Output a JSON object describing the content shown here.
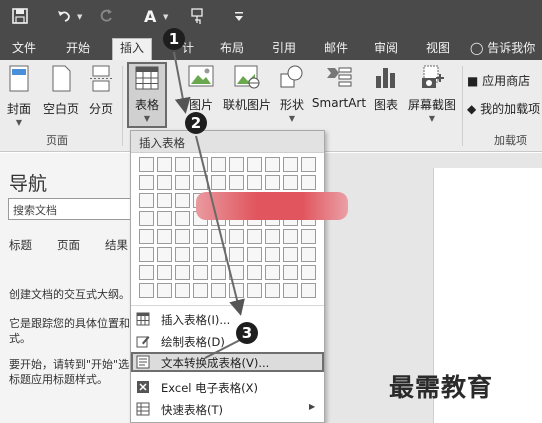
{
  "quick_access": {
    "save_icon": "save-icon",
    "undo_icon": "undo-icon",
    "redo_icon": "redo-icon",
    "format_icon": "text-format-icon",
    "touch_icon": "touch-mode-icon",
    "customize_icon": "customize-icon"
  },
  "tabs": [
    "文件",
    "开始",
    "插入",
    "计",
    "布局",
    "引用",
    "邮件",
    "审阅",
    "视图"
  ],
  "tell_me": "告诉我你",
  "ribbon": {
    "cover": "封面",
    "blank_page": "空白页",
    "page_break": "分页",
    "table": "表格",
    "pictures": "图片",
    "online_pictures": "联机图片",
    "shapes": "形状",
    "smartart": "SmartArt",
    "chart": "图表",
    "screenshot": "屏幕截图",
    "store": "应用商店",
    "my_addins": "我的加载项",
    "group_pages": "页面",
    "group_addins": "加载项"
  },
  "nav": {
    "title": "导航",
    "search_placeholder": "搜索文档",
    "tab_headings": "标题",
    "tab_pages": "页面",
    "tab_results": "结果",
    "line1": "创建文档的交互式大纲。",
    "line2a": "它是跟踪您的具体位置和",
    "line2b": "式。",
    "line3a": "要开始，请转到\"开始\"选",
    "line3b": "标题应用标题样式。"
  },
  "dropdown": {
    "header": "插入表格",
    "items": [
      "插入表格(I)...",
      "绘制表格(D)",
      "文本转换成表格(V)...",
      "Excel 电子表格(X)",
      "快速表格(T)"
    ]
  },
  "badges": [
    "1",
    "2",
    "3"
  ],
  "watermark": "最需教育"
}
